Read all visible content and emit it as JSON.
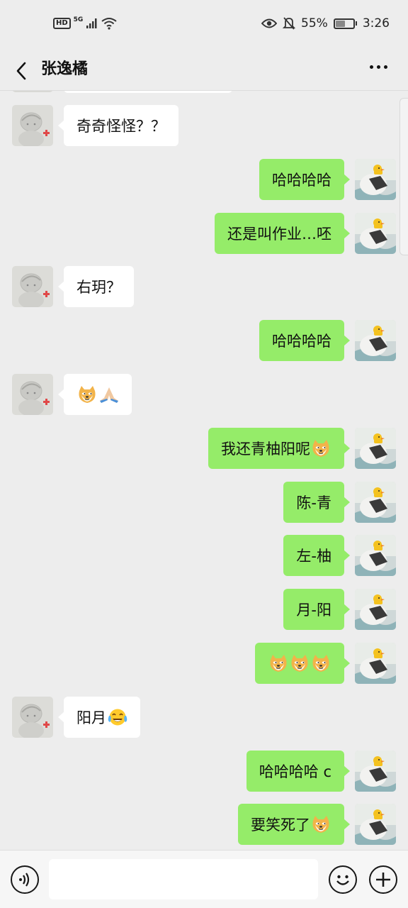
{
  "status_bar": {
    "hd": "HD",
    "network": "5G",
    "battery": "55%",
    "battery_level": 0.55,
    "time": "3:26",
    "icons": [
      "signal-icon",
      "wifi-icon",
      "eye-icon",
      "bell-off-icon",
      "battery-icon"
    ]
  },
  "header": {
    "title": "张逸橘",
    "back_icon": "chevron-left-icon",
    "more_icon": "more-horizontal-icon"
  },
  "messages": [
    {
      "side": "in",
      "text": "奇奇怪怪？？"
    },
    {
      "side": "out",
      "text": "哈哈哈哈"
    },
    {
      "side": "out",
      "text": "还是叫作业…呸"
    },
    {
      "side": "in",
      "text": "右玥？"
    },
    {
      "side": "out",
      "text": "哈哈哈哈"
    },
    {
      "side": "in",
      "text": "",
      "emojis": [
        "doge-emoji",
        "pray-emoji"
      ]
    },
    {
      "side": "out",
      "text": "我还青柚阳呢",
      "emojis": [
        "doge-emoji"
      ]
    },
    {
      "side": "out",
      "text": "陈-青"
    },
    {
      "side": "out",
      "text": "左-柚"
    },
    {
      "side": "out",
      "text": "月-阳"
    },
    {
      "side": "out",
      "text": "",
      "emojis": [
        "doge-emoji",
        "doge-emoji",
        "doge-emoji"
      ]
    },
    {
      "side": "in",
      "text": "阳月",
      "emojis": [
        "tears-of-joy-emoji"
      ]
    },
    {
      "side": "out",
      "text": "哈哈哈哈 c"
    },
    {
      "side": "out",
      "text": "要笑死了",
      "emojis": [
        "doge-emoji"
      ]
    }
  ],
  "input_bar": {
    "placeholder": "",
    "voice_icon": "voice-icon",
    "emoji_icon": "smiley-icon",
    "plus_icon": "plus-icon"
  },
  "colors": {
    "background": "#ededed",
    "outgoing_bubble": "#95ec69",
    "incoming_bubble": "#ffffff"
  }
}
